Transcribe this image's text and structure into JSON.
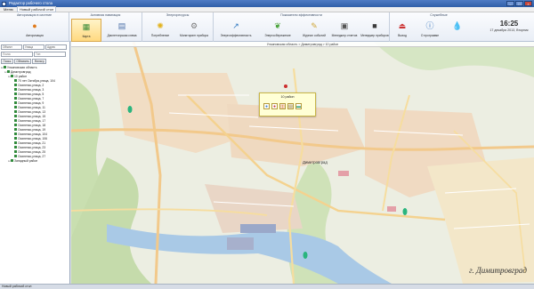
{
  "window": {
    "title": "Редактор рабочего стола"
  },
  "menu": {
    "label": "Меню"
  },
  "workspace_tab": {
    "label": "Новый рабочий стол"
  },
  "ribbon": {
    "groups": [
      {
        "title": "Авторизация в системе"
      },
      {
        "title": "Активная навигация"
      },
      {
        "title": "Энергоресурсы"
      },
      {
        "title": "Показатели эффективности"
      },
      {
        "title": "Служебные"
      }
    ],
    "buttons": [
      {
        "label": "Авторизация",
        "icon": "user-icon"
      },
      {
        "label": "Карта",
        "icon": "map-icon"
      },
      {
        "label": "Диспетчерская схема",
        "icon": "scheme-icon"
      },
      {
        "label": "Потребление",
        "icon": "bulb-icon"
      },
      {
        "label": "Мониторинг прибора",
        "icon": "monitor-icon"
      },
      {
        "label": "Энергоэффективность",
        "icon": "chart-icon"
      },
      {
        "label": "Энергосбережение",
        "icon": "leaf-icon"
      },
      {
        "label": "Журнал событий",
        "icon": "journal-icon"
      },
      {
        "label": "Менеджер отчетов",
        "icon": "report-icon"
      },
      {
        "label": "Менеджер приборов",
        "icon": "device-icon"
      },
      {
        "label": "Выход",
        "icon": "exit-icon"
      },
      {
        "label": "О программе",
        "icon": "about-icon"
      }
    ],
    "clock": {
      "time": "16:25",
      "date": "17 декабря 2013, Вторник"
    }
  },
  "left_panel": {
    "search_placeholder": "Поиск",
    "controls_row1": [
      "Объект",
      "Улица",
      "Адрес"
    ],
    "filter_placeholder": "Тип",
    "controls_row3": {
      "search_button": "Поиск",
      "refresh_button": "Обновить",
      "filter_button": "Фильтр"
    },
    "tree": [
      {
        "label": "Ульяновская область",
        "level": 0
      },
      {
        "label": "Димитровград",
        "level": 1
      },
      {
        "label": "10 район",
        "level": 2
      },
      {
        "label": "70 лет Октября,улица, 104",
        "level": 3
      },
      {
        "label": "Осипенко,улица, 2",
        "level": 3
      },
      {
        "label": "Осипенко,улица, 3",
        "level": 3
      },
      {
        "label": "Осипенко,улица, 5",
        "level": 3
      },
      {
        "label": "Осипенко,улица, 7",
        "level": 3
      },
      {
        "label": "Осипенко,улица, 9",
        "level": 3
      },
      {
        "label": "Осипенко,улица, 11",
        "level": 3
      },
      {
        "label": "Осипенко,улица, 13",
        "level": 3
      },
      {
        "label": "Осипенко,улица, 15",
        "level": 3
      },
      {
        "label": "Осипенко,улица, 17",
        "level": 3
      },
      {
        "label": "Осипенко,улица, 18",
        "level": 3
      },
      {
        "label": "Осипенко,улица, 19",
        "level": 3
      },
      {
        "label": "Осипенко,улица, 104",
        "level": 3
      },
      {
        "label": "Осипенко,улица, 106",
        "level": 3
      },
      {
        "label": "Осипенко,улица, 21",
        "level": 3
      },
      {
        "label": "Осипенко,улица, 23",
        "level": 3
      },
      {
        "label": "Осипенко,улица, 25",
        "level": 3
      },
      {
        "label": "Осипенко,улица, 27",
        "level": 3
      },
      {
        "label": "Западный район",
        "level": 2
      }
    ]
  },
  "map": {
    "breadcrumb": "Ульяновская область > Димитровград > 10 район",
    "city_label": "Димитровград",
    "corner_label": "г. Димитровград",
    "popup": {
      "title": "10 район"
    }
  },
  "status_bar": {
    "text": "Новый рабочий стол"
  }
}
